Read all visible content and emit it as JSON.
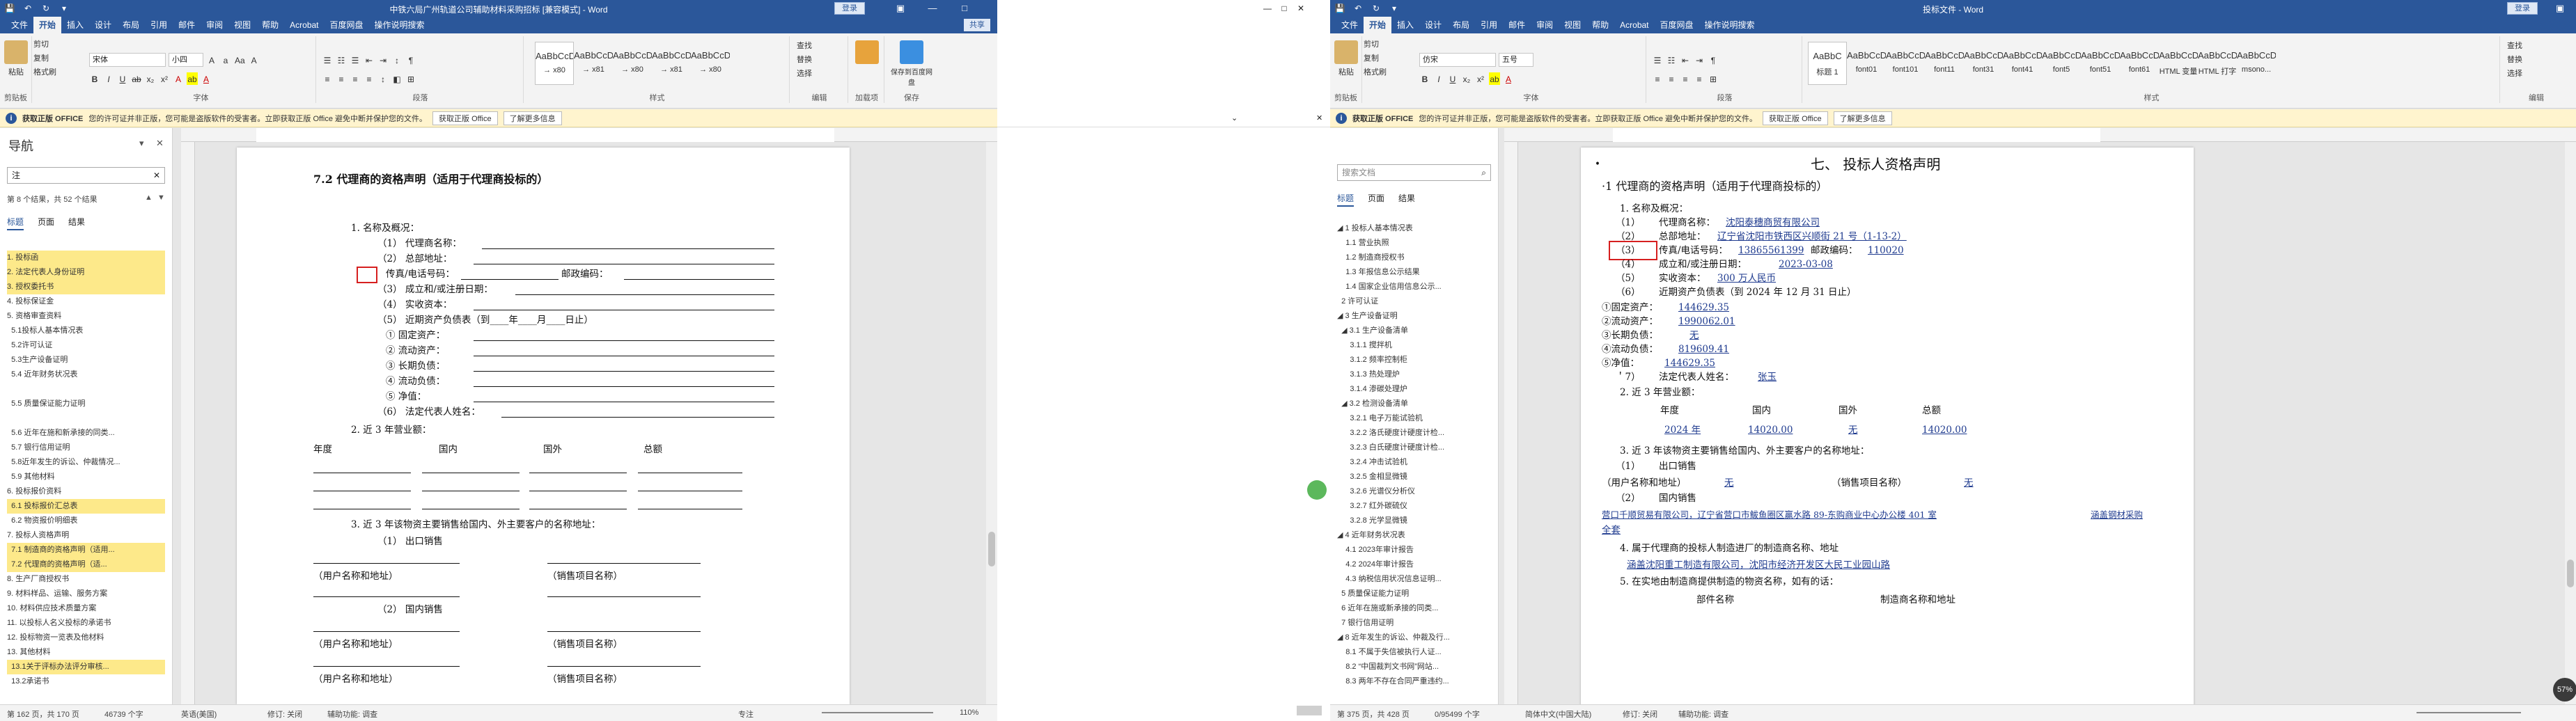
{
  "left": {
    "qat": {
      "save": "💾",
      "undo": "↶",
      "redo": "↻",
      "more": "▾"
    },
    "title": "中铁六局广州轨道公司辅助材料采购招标 [兼容模式] - Word",
    "login": "登录",
    "wc": {
      "ribbon": "▣",
      "min": "—",
      "max": "□",
      "close": "✕"
    },
    "menus": [
      "文件",
      "开始",
      "插入",
      "设计",
      "布局",
      "引用",
      "邮件",
      "审阅",
      "视图",
      "帮助",
      "Acrobat",
      "百度网盘",
      "操作说明搜索"
    ],
    "share": "共享",
    "ribbon": {
      "paste": "粘贴",
      "clip_items": [
        "剪切",
        "复制",
        "格式刷"
      ],
      "clip_label": "剪贴板",
      "font_name": "宋体",
      "font_size": "小四",
      "font_label": "字体",
      "para_label": "段落",
      "styles": [
        {
          "preview": "AaBbCcD",
          "name": "→ x80"
        },
        {
          "preview": "AaBbCcDd",
          "name": "→ x81"
        },
        {
          "preview": "AaBbCcDd",
          "name": "→ x80"
        },
        {
          "preview": "AaBbCcDd",
          "name": "→ x81"
        },
        {
          "preview": "AaBbCcD",
          "name": "→ x80"
        }
      ],
      "styles_label": "样式",
      "edit_items": [
        "查找",
        "替换",
        "选择"
      ],
      "edit_label": "编辑",
      "addin": "加载项",
      "baidu_save": "保存到百度网盘",
      "save_label": "保存"
    },
    "notice": {
      "badge": "获取正版 OFFICE",
      "text": "您的许可证并非正版，您可能是盗版软件的受害者。立即获取正版 Office 避免中断并保护您的文件。",
      "btn1": "获取正版 Office",
      "btn2": "了解更多信息",
      "close": "✕"
    },
    "nav": {
      "title": "导航",
      "search": "注",
      "results": "第 8 个结果，共 52 个结果",
      "tabs": [
        "标题",
        "页面",
        "结果"
      ],
      "items": [
        {
          "t": "1. 投标函",
          "s": "hl"
        },
        {
          "t": "2. 法定代表人身份证明",
          "s": "hl"
        },
        {
          "t": "3. 授权委托书",
          "s": "hl"
        },
        {
          "t": "4. 投标保证金",
          "s": ""
        },
        {
          "t": "5. 资格审查资料",
          "s": ""
        },
        {
          "t": "  5.1投标人基本情况表",
          "s": ""
        },
        {
          "t": "  5.2许可认证",
          "s": ""
        },
        {
          "t": "  5.3生产设备证明",
          "s": ""
        },
        {
          "t": "  5.4 近年财务状况表",
          "s": ""
        },
        {
          "t": "",
          "s": ""
        },
        {
          "t": "  5.5 质量保证能力证明",
          "s": ""
        },
        {
          "t": "",
          "s": ""
        },
        {
          "t": "  5.6 近年在施和新承接的同类...",
          "s": ""
        },
        {
          "t": "  5.7 银行信用证明",
          "s": ""
        },
        {
          "t": "  5.8近年发生的诉讼、仲裁情况...",
          "s": ""
        },
        {
          "t": "  5.9 其他材料",
          "s": ""
        },
        {
          "t": "6. 投标报价资料",
          "s": ""
        },
        {
          "t": "  6.1 投标报价汇总表",
          "s": "hl"
        },
        {
          "t": "  6.2 物资报价明细表",
          "s": ""
        },
        {
          "t": "7. 投标人资格声明",
          "s": ""
        },
        {
          "t": "  7.1 制造商的资格声明（适用...",
          "s": "hl"
        },
        {
          "t": "  7.2 代理商的资格声明（适...",
          "s": "hl"
        },
        {
          "t": "8. 生产厂商授权书",
          "s": ""
        },
        {
          "t": "9. 材料样品、运输、服务方案",
          "s": ""
        },
        {
          "t": "10. 材料供应技术质量方案",
          "s": ""
        },
        {
          "t": "11. 以投标人名义投标的承诺书",
          "s": ""
        },
        {
          "t": "12. 投标物资一览表及他材料",
          "s": ""
        },
        {
          "t": "13. 其他材料",
          "s": ""
        },
        {
          "t": "  13.1关于评标办法评分审核...",
          "s": "hl"
        },
        {
          "t": "  13.2承诺书",
          "s": ""
        }
      ]
    },
    "doc": {
      "heading": "7.2  代理商的资格声明（适用于代理商投标的）",
      "l1": "1.  名称及概况：",
      "l2": "（1）  代理商名称：",
      "l3": "（2）  总部地址：",
      "l4": "传真/电话号码：",
      "l4b": "邮政编码：",
      "l5": "（3）  成立和/或注册日期：",
      "l6": "（4）  实收资本：",
      "l7": "（5）  近期资产负债表（到____年____月____日止）",
      "l8": "①   固定资产：",
      "l9": "②   流动资产：",
      "l10": "③   长期负债：",
      "l11": "④   流动负债：",
      "l12": "⑤   净值：",
      "l13": "（6）  法定代表人姓名：",
      "l14": "2.  近 3 年营业额：",
      "cols": [
        "年度",
        "国内",
        "国外",
        "总额"
      ],
      "l15": "3.  近 3 年该物资主要销售给国内、外主要客户的名称地址：",
      "l16": "（1）  出口销售",
      "buyer": "（用户名称和地址）",
      "item": "（销售项目名称）",
      "l17": "（2）  国内销售"
    },
    "status": {
      "page": "第 162 页，共 170 页",
      "words": "46739 个字",
      "lang": "英语(美国)",
      "track": "修订: 关闭",
      "access": "辅助功能: 调查",
      "focus": "专注",
      "zoom": "110%"
    }
  },
  "right": {
    "title": "投标文件 - Word",
    "login": "登录",
    "menus": [
      "文件",
      "开始",
      "插入",
      "设计",
      "布局",
      "引用",
      "邮件",
      "审阅",
      "视图",
      "帮助",
      "Acrobat",
      "百度网盘",
      "操作说明搜索"
    ],
    "ribbon": {
      "font_name": "仿宋",
      "font_size": "五号",
      "styles": [
        {
          "preview": "AaBbC",
          "name": "标题 1"
        },
        {
          "preview": "AaBbCcDc",
          "name": "font01"
        },
        {
          "preview": "AaBbCcDc",
          "name": "font101"
        },
        {
          "preview": "AaBbCcDc",
          "name": "font11"
        },
        {
          "preview": "AaBbCcDc",
          "name": "font31"
        },
        {
          "preview": "AaBbCcDc",
          "name": "font41"
        },
        {
          "preview": "AaBbCcDc",
          "name": "font5"
        },
        {
          "preview": "AaBbCcDc",
          "name": "font51"
        },
        {
          "preview": "AaBbCcDc",
          "name": "font61"
        },
        {
          "preview": "AaBbCcDc",
          "name": "HTML 变量"
        },
        {
          "preview": "AaBbCcDc",
          "name": "HTML 打字"
        },
        {
          "preview": "AaBbCcDc",
          "name": "msono..."
        }
      ]
    },
    "nav": {
      "search_placeholder": "搜索文档",
      "items": [
        {
          "t": "◢ 1 投标人基本情况表",
          "s": ""
        },
        {
          "t": "    1.1 营业执照",
          "s": ""
        },
        {
          "t": "    1.2 制造商授权书",
          "s": ""
        },
        {
          "t": "    1.3 年报信息公示结果",
          "s": ""
        },
        {
          "t": "    1.4 国家企业信用信息公示...",
          "s": ""
        },
        {
          "t": "  2 许可认证",
          "s": ""
        },
        {
          "t": "◢ 3 生产设备证明",
          "s": ""
        },
        {
          "t": "  ◢ 3.1 生产设备清单",
          "s": ""
        },
        {
          "t": "      3.1.1 搅拌机",
          "s": ""
        },
        {
          "t": "      3.1.2 频率控制柜",
          "s": ""
        },
        {
          "t": "      3.1.3 热处理炉",
          "s": ""
        },
        {
          "t": "      3.1.4 渗碳处理炉",
          "s": ""
        },
        {
          "t": "  ◢ 3.2 检测设备清单",
          "s": ""
        },
        {
          "t": "      3.2.1 电子万能试验机",
          "s": ""
        },
        {
          "t": "      3.2.2 洛氏硬度计硬度计检...",
          "s": ""
        },
        {
          "t": "      3.2.3 白氏硬度计硬度计检...",
          "s": ""
        },
        {
          "t": "      3.2.4 冲击试验机",
          "s": ""
        },
        {
          "t": "      3.2.5 金相显微镜",
          "s": ""
        },
        {
          "t": "      3.2.6 光谱仪分析仪",
          "s": ""
        },
        {
          "t": "      3.2.7 红外碳硫仪",
          "s": ""
        },
        {
          "t": "      3.2.8 光学显微镜",
          "s": ""
        },
        {
          "t": "◢ 4 近年财务状况表",
          "s": ""
        },
        {
          "t": "    4.1 2023年审计报告",
          "s": ""
        },
        {
          "t": "    4.2 2024年审计报告",
          "s": ""
        },
        {
          "t": "    4.3 纳税信用状况信息证明...",
          "s": ""
        },
        {
          "t": "  5 质量保证能力证明",
          "s": ""
        },
        {
          "t": "  6 近年在施或新承接的同类...",
          "s": ""
        },
        {
          "t": "  7 银行信用证明",
          "s": ""
        },
        {
          "t": "◢ 8 近年发生的诉讼、仲裁及行...",
          "s": ""
        },
        {
          "t": "    8.1 不属于失信被执行人证...",
          "s": ""
        },
        {
          "t": "    8.2 “中国裁判文书网”网站...",
          "s": ""
        },
        {
          "t": "    8.3 两年不存在合同严重违约...",
          "s": ""
        }
      ]
    },
    "doc": {
      "heading": "七、 投标人资格声明",
      "sub": "·1  代理商的资格声明（适用于代理商投标的）",
      "l1": "1.  名称及概况：",
      "l2a": "（1）",
      "l2b": "代理商名称：",
      "l2v": "沈阳泰穗商贸有限公司",
      "l3a": "（2）",
      "l3b": "总部地址：",
      "l3v": "辽宁省沈阳市铁西区兴顺街 21 号（1-13-2）",
      "l4a": "（3）",
      "l4b": "传真/电话号码：",
      "l4v": "13865561399",
      "l4c": "邮政编码：",
      "l4w": "110020",
      "l5a": "（4）",
      "l5b": "成立和/或注册日期：",
      "l5v": "2023-03-08",
      "l6a": "（5）",
      "l6b": "实收资本：",
      "l6v": "300 万人民币",
      "l7a": "（6）",
      "l7b": "近期资产负债表（到 2024 年 12 月 31 日止）",
      "a1": "①固定资产：",
      "a1v": "144629.35",
      "a2": "②流动资产：",
      "a2v": "1990062.01",
      "a3": "③长期负债：",
      "a3v": "无",
      "a4": "④流动负债：",
      "a4v": "819609.41",
      "a5": "⑤净值：",
      "a5v": "144629.35",
      "l8a": "＇7）",
      "l8b": "法定代表人姓名：",
      "l8v": "张玉",
      "l9": "2.  近 3 年营业额：",
      "cols": [
        "年度",
        "国内",
        "国外",
        "总额"
      ],
      "row": [
        "2024 年",
        "14020.00",
        "无",
        "14020.00"
      ],
      "l10": "3.  近 3 年该物资主要销售给国内、外主要客户的名称地址：",
      "l11a": "（1）",
      "l11b": "出口销售",
      "buyer": "（用户名称和地址）",
      "buyer_v": "无",
      "item": "（销售项目名称）",
      "item_v": "无",
      "l12a": "（2）",
      "l12b": "国内销售",
      "l13": "营口千顺贸易有限公司，辽宁省营口市鲅鱼圈区赢水路 89-东购商业中心办公楼 401 室",
      "l13b": "涵盖钢材采购",
      "l13c": "全套",
      "l14": "4.  属于代理商的投标人制造进厂的制造商名称、地址",
      "l14v": "涵盖沈阳重工制造有限公司，沈阳市经济开发区大民工业园山路",
      "l15": "5.  在实地由制造商提供制造的物资名称，如有的话：",
      "l16a": "部件名称",
      "l16b": "制造商名称和地址"
    },
    "status": {
      "page": "第 375 页，共 428 页",
      "words": "0/95499 个字",
      "lang": "简体中文(中国大陆)",
      "track": "修订: 关闭",
      "access": "辅助功能: 调查",
      "zoom": "57%"
    }
  },
  "middle": {
    "wc": {
      "min": "—",
      "max": "□",
      "close": "✕"
    },
    "chev": "⌄"
  },
  "colors": {
    "word_blue": "#2b579a",
    "highlight": "#fde98a",
    "notice_bg": "#fff4ce",
    "redbox": "#d61f1f"
  }
}
